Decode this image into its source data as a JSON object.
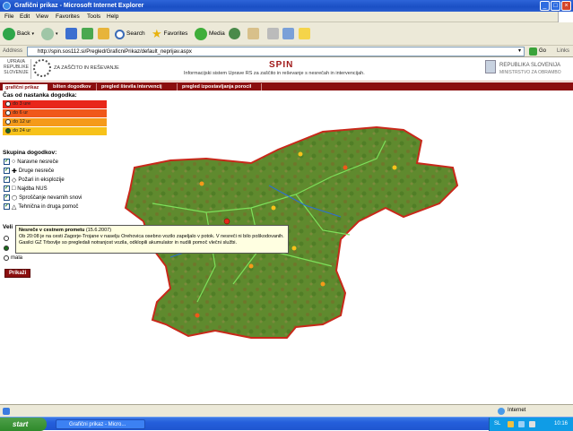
{
  "window": {
    "title": "Grafični prikaz - Microsoft Internet Explorer"
  },
  "menu": [
    "File",
    "Edit",
    "View",
    "Favorites",
    "Tools",
    "Help"
  ],
  "toolbar": {
    "back": "Back",
    "search": "Search",
    "favorites": "Favorites",
    "media": "Media",
    "links": "Links",
    "go": "Go"
  },
  "address": {
    "label": "Address",
    "url": "http://spin.sos112.si/Pregled/GraficniPrikaz/default_neprijav.aspx"
  },
  "header": {
    "logo_lines": [
      "UPRAVA",
      "REPUBLIKE",
      "SLOVENIJE"
    ],
    "logo_text": "ZA ZAŠČITO IN REŠEVANJE",
    "title": "SPIN",
    "subtitle": "Informacijski sistem Uprave RS za zaščito in reševanje s nesrečah in intervencijah.",
    "right_line1": "REPUBLIKA SLOVENIJA",
    "right_line2": "MINISTRSTVO ZA OBRAMBO"
  },
  "tabs": [
    "grafični prikaz",
    "bilten dogodkov",
    "pregled števila intervencij",
    "pregled izpostavljanja porocil"
  ],
  "sidebar": {
    "time_heading": "Čas od nastanka dogodka:",
    "time_options": [
      {
        "label": "do 3 ure",
        "color": "#e8271a"
      },
      {
        "label": "do 6 ur",
        "color": "#f0581a"
      },
      {
        "label": "do 12 ur",
        "color": "#f59a1a"
      },
      {
        "label": "do 24 ur",
        "color": "#f7c21a"
      }
    ],
    "group_heading": "Skupina dogodkov:",
    "groups": [
      "Naravne nesreče",
      "Druge nesreče",
      "Požari in eksplozije",
      "Najdba NUS",
      "Sproščanje nevarnih snovi",
      "Tehnična in druga pomoč"
    ],
    "size_heading": "Veli",
    "size_options": [
      "",
      "",
      "mala"
    ],
    "button": "Prikaži"
  },
  "tooltip": {
    "title": "Nesreče v cestnem prometu",
    "date": "(15.6.2007)",
    "text": "Ob 20:08 je na cesti Zagorje-Trojane v naselju Orehovica osebno vozilo zapeljalo v potok. V nesreči ni bilo poškodovanih. Gasilci GZ Trbovlje so pregledali notranjost vozila, odklopili akumulator in nudili pomoč vlečni službi."
  },
  "status": {
    "zone": "Internet"
  },
  "taskbar": {
    "start": "start",
    "item": "Grafični prikaz - Micro...",
    "lang": "SL",
    "time": "10:16"
  }
}
